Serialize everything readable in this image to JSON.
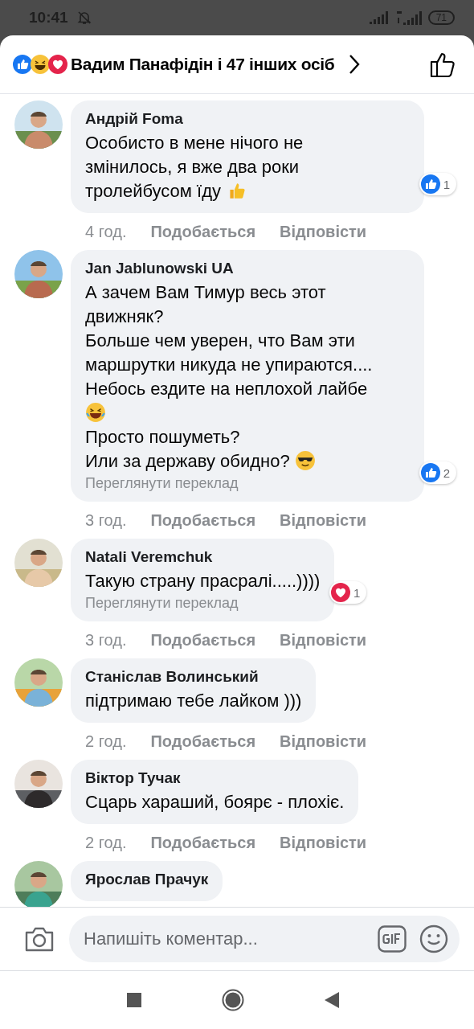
{
  "status_bar": {
    "time": "10:41",
    "battery": "71"
  },
  "header": {
    "reactions": [
      {
        "kind": "like"
      },
      {
        "kind": "haha"
      },
      {
        "kind": "love"
      }
    ],
    "title": "Вадим Панафідін і 47 інших осіб"
  },
  "comments": [
    {
      "author": "Андрій Foma",
      "paragraphs": [
        {
          "text": "Особисто в мене нічого не"
        },
        {
          "text": "змінилось, я вже два роки"
        },
        {
          "text": "тролейбусом їду",
          "kind": "thumb"
        }
      ],
      "reaction": {
        "kind": "like",
        "count": "1"
      },
      "time": "4 год.",
      "like_label": "Подобається",
      "reply_label": "Відповісти"
    },
    {
      "author": "Jan Jablunowski UA",
      "paragraphs": [
        {
          "text": "А зачем Вам Тимур весь этот"
        },
        {
          "text": "движняк?"
        },
        {
          "text": "Больше чем уверен, что Вам эти"
        },
        {
          "text": "маршрутки никуда не упираются...."
        },
        {
          "text": "Небось ездите на неплохой лайбе"
        },
        {
          "kind": "laugh"
        },
        {
          "text": "Просто пошуметь?"
        },
        {
          "text": "Или за державу обидно?",
          "kind": "cool"
        }
      ],
      "translation": "Переглянути переклад",
      "reaction": {
        "kind": "like",
        "count": "2"
      },
      "time": "3 год.",
      "like_label": "Подобається",
      "reply_label": "Відповісти"
    },
    {
      "author": "Natali Veremchuk",
      "paragraphs": [
        {
          "text": "Такую страну прасралі.....))))"
        }
      ],
      "translation": "Переглянути переклад",
      "reaction": {
        "kind": "love",
        "count": "1"
      },
      "time": "3 год.",
      "like_label": "Подобається",
      "reply_label": "Відповісти"
    },
    {
      "author": "Станіслав Волинський",
      "paragraphs": [
        {
          "text": "підтримаю тебе лайком )))"
        }
      ],
      "time": "2 год.",
      "like_label": "Подобається",
      "reply_label": "Відповісти"
    },
    {
      "author": "Віктор Тучак",
      "paragraphs": [
        {
          "text": "Сцарь хараший, боярє - плохіє."
        }
      ],
      "time": "2 год.",
      "like_label": "Подобається",
      "reply_label": "Відповісти"
    },
    {
      "author": "Ярослав Прачук"
    }
  ],
  "composer": {
    "placeholder": "Напишіть коментар..."
  }
}
